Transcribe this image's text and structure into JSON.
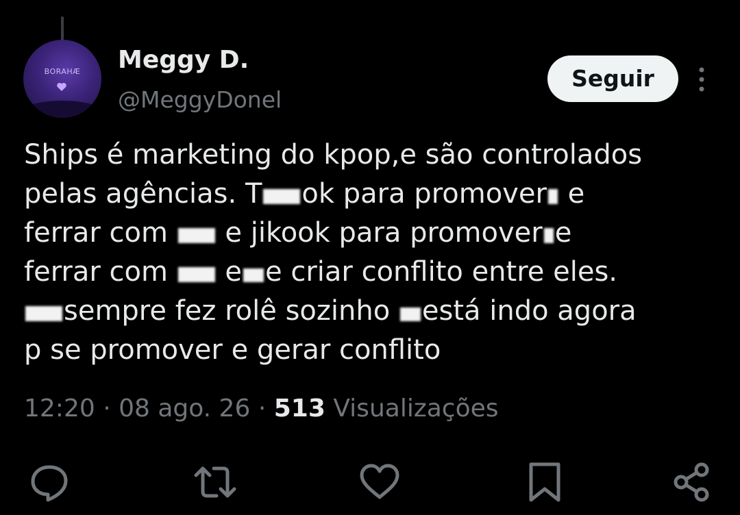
{
  "tweet": {
    "author": {
      "display_name": "Meggy D.",
      "handle": "@MeggyDonel",
      "avatar_text": "BORAHÆ"
    },
    "follow_label": "Seguir",
    "body_lines": [
      [
        "Ships é marketing do kpop,e são controlados"
      ],
      [
        "pelas agências. ",
        "T",
        "",
        "ok para promover",
        "",
        " e"
      ],
      [
        "ferrar com ",
        "",
        " e jikook para promover",
        "",
        "e"
      ],
      [
        "ferrar com ",
        "",
        " e",
        "",
        "e criar conflito entre eles."
      ],
      [
        "",
        "sempre fez rolê sozinho",
        "",
        "está indo agora"
      ],
      [
        "p se promover e gerar conflito"
      ]
    ],
    "meta": {
      "time": "12:20",
      "date": "08 ago. 26",
      "views_count": "513",
      "views_label": "Visualizações",
      "separator": "·"
    }
  },
  "actions": {
    "reply": "reply-icon",
    "retweet": "retweet-icon",
    "like": "heart-icon",
    "bookmark": "bookmark-icon",
    "share": "share-icon"
  },
  "colors": {
    "background": "#000000",
    "text_primary": "#e7e9ea",
    "text_secondary": "#71767b",
    "button_bg": "#eff3f4",
    "avatar_purple": "#3b2378"
  }
}
